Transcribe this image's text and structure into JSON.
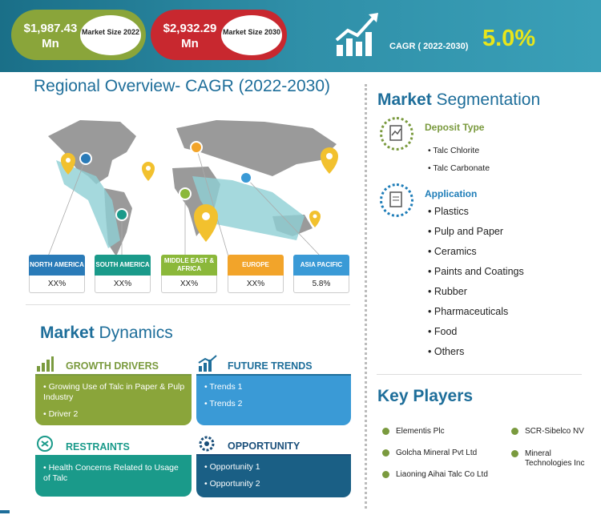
{
  "header": {
    "size_2022_value": "$1,987.43 Mn",
    "size_2022_label": "Market Size 2022",
    "size_2030_value": "$2,932.29 Mn",
    "size_2030_label": "Market Size 2030",
    "cagr_label": "CAGR ( 2022-2030)",
    "cagr_value": "5.0%",
    "colors": {
      "green": "#8aa53a",
      "red": "#c8282f",
      "teal": "#1e7d95",
      "yellow": "#e8e61a"
    }
  },
  "regional": {
    "title_a": "Regional ",
    "title_b": "Overview- CAGR (2022-2030)",
    "regions": [
      {
        "name": "NORTH AMERICA",
        "value": "XX%",
        "color": "#2a7bb8"
      },
      {
        "name": "SOUTH AMERICA",
        "value": "XX%",
        "color": "#1a9a8a"
      },
      {
        "name": "MIDDLE EAST & AFRICA",
        "value": "XX%",
        "color": "#8bb83a"
      },
      {
        "name": "EUROPE",
        "value": "XX%",
        "color": "#f2a42a"
      },
      {
        "name": "ASIA PACIFIC",
        "value": "5.8%",
        "color": "#3a9ad6"
      }
    ]
  },
  "dynamics": {
    "title_a": "Market ",
    "title_b": "Dynamics",
    "growth_drivers": {
      "title": "GROWTH DRIVERS",
      "items": [
        "Growing Use of Talc in Paper & Pulp Industry",
        "Driver 2"
      ]
    },
    "future_trends": {
      "title": "FUTURE TRENDS",
      "items": [
        "Trends 1",
        "Trends 2"
      ]
    },
    "restraints": {
      "title": "RESTRAINTS",
      "items": [
        "Health Concerns Related to Usage of Talc"
      ]
    },
    "opportunity": {
      "title": "OPPORTUNITY",
      "items": [
        "Opportunity 1",
        "Opportunity 2"
      ]
    }
  },
  "segmentation": {
    "title_a": "Market ",
    "title_b": "Segmentation",
    "deposit_type": {
      "title": "Deposit Type",
      "items": [
        "Talc Chlorite",
        "Talc Carbonate"
      ]
    },
    "application": {
      "title": "Application",
      "items": [
        "Plastics",
        "Pulp and Paper",
        "Ceramics",
        "Paints and Coatings",
        "Rubber",
        "Pharmaceuticals",
        "Food",
        "Others"
      ]
    }
  },
  "key_players": {
    "title": "Key Players",
    "players": [
      "Elementis Plc",
      "Golcha Mineral Pvt Ltd",
      "Liaoning Aihai Talc Co Ltd",
      "SCR-Sibelco NV",
      "Mineral Technologies Inc"
    ]
  }
}
